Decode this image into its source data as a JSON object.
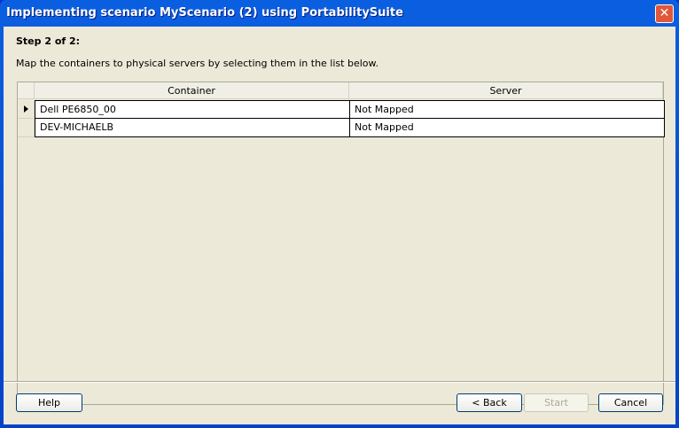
{
  "window": {
    "title": "Implementing scenario MyScenario (2) using PortabilitySuite",
    "close": "✕"
  },
  "step": "Step 2 of 2:",
  "description": "Map the containers to physical servers by selecting them in the list below.",
  "grid": {
    "columns": [
      "Container",
      "Server"
    ],
    "rows": [
      {
        "container": "Dell PE6850_00",
        "server": "Not Mapped",
        "current": true
      },
      {
        "container": "DEV-MICHAELB",
        "server": "Not Mapped",
        "current": false
      }
    ]
  },
  "buttons": {
    "help": "Help",
    "back": "< Back",
    "start": "Start",
    "cancel": "Cancel"
  }
}
